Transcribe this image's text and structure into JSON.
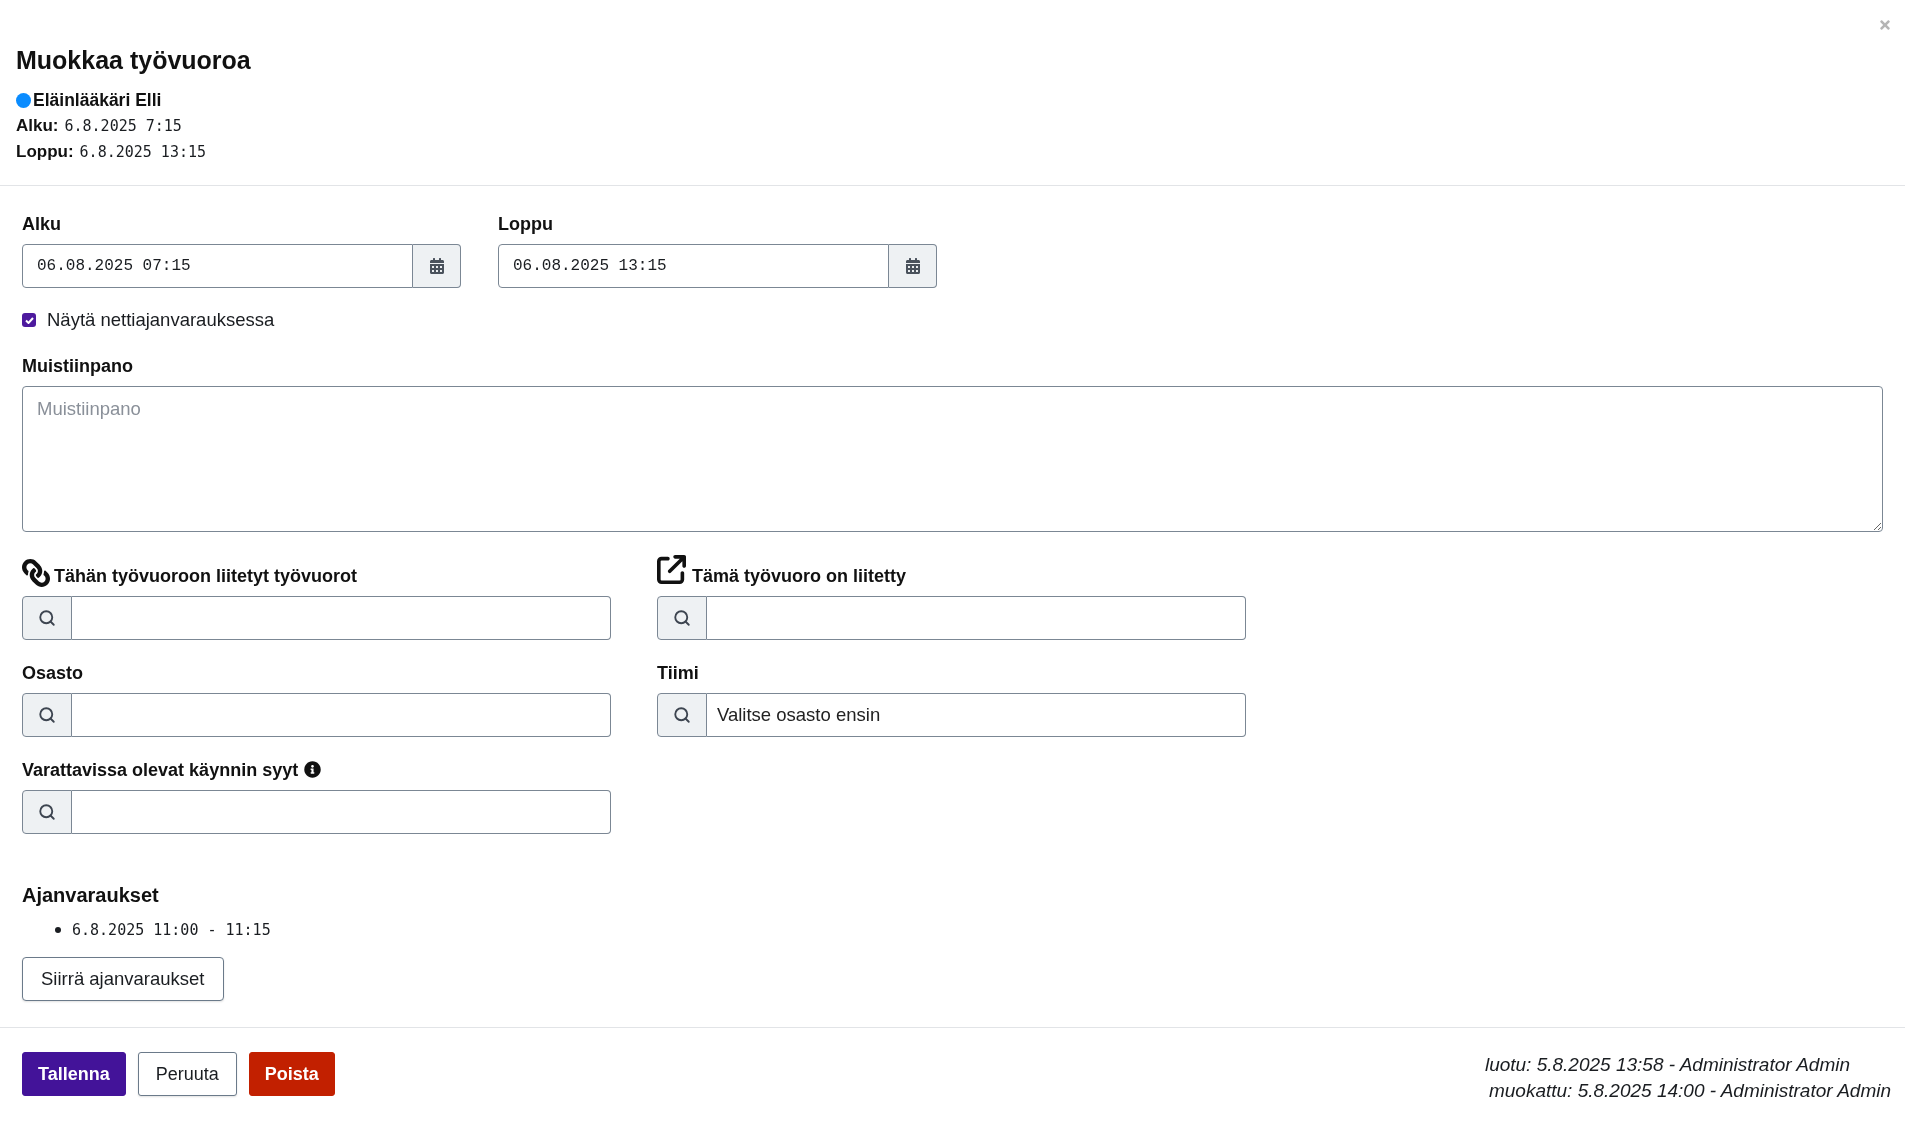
{
  "dialog": {
    "title": "Muokkaa työvuoroa"
  },
  "summary": {
    "employee": {
      "name": "Eläinlääkäri Elli",
      "color": "#0a8cff"
    },
    "lines": [
      {
        "label": "Alku:",
        "value": "6.8.2025 7:15"
      },
      {
        "label": "Loppu:",
        "value": "6.8.2025 13:15"
      }
    ]
  },
  "date_fields": [
    {
      "label": "Alku",
      "value": "06.08.2025 07:15"
    },
    {
      "label": "Loppu",
      "value": "06.08.2025 13:15"
    }
  ],
  "show_online": {
    "label": "Näytä nettiajanvarauksessa",
    "checked": true
  },
  "note": {
    "label": "Muistiinpano",
    "placeholder": "Muistiinpano"
  },
  "search_fields": [
    {
      "kind": "chain",
      "label": "Tähän työvuoroon liitetyt työvuorot"
    },
    {
      "kind": "external",
      "label": "Tämä työvuoro on liitetty"
    },
    {
      "kind": "plain",
      "label": "Osasto"
    },
    {
      "kind": "plain",
      "label": "Tiimi",
      "placeholder": "Valitse osasto ensin"
    },
    {
      "kind": "info",
      "label": "Varattavissa olevat käynnin syyt"
    }
  ],
  "bookings": {
    "title": "Ajanvaraukset",
    "items": [
      "6.8.2025 11:00 - 11:15"
    ],
    "button": "Siirrä ajanvaraukset"
  },
  "footer": {
    "buttons": [
      {
        "kind": "primary",
        "label": "Tallenna"
      },
      {
        "kind": "secondary",
        "label": "Peruuta"
      },
      {
        "kind": "danger",
        "label": "Poista"
      }
    ],
    "meta": [
      "luotu: 5.8.2025 13:58 - Administrator Admin",
      "muokattu: 5.8.2025 14:00 - Administrator Admin"
    ]
  }
}
